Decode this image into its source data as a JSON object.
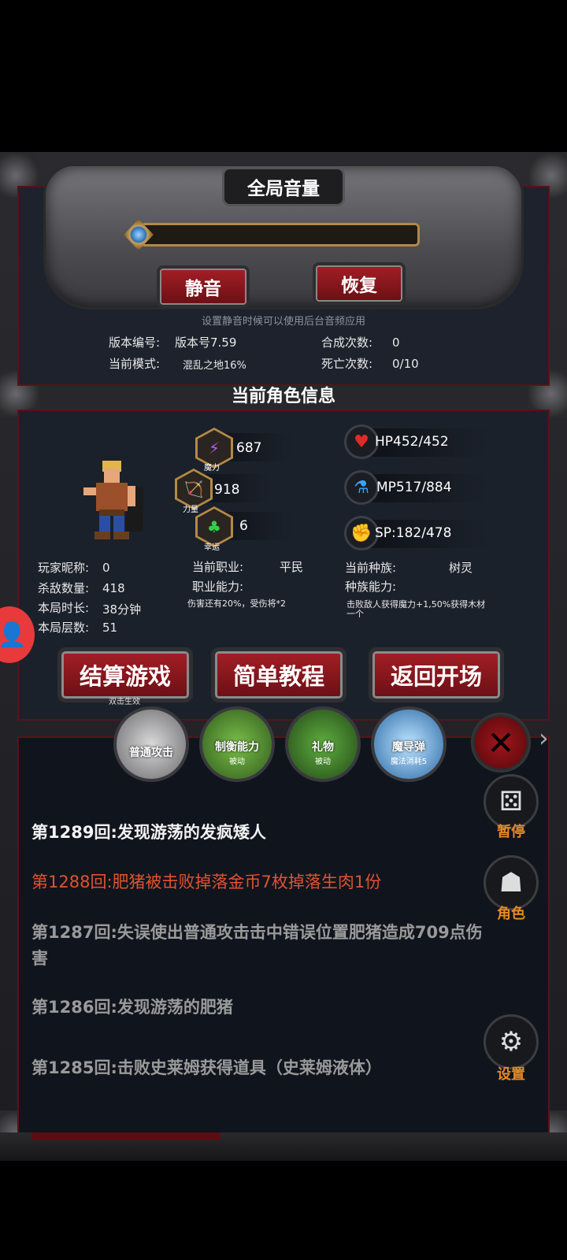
{
  "colors": {
    "accent_red": "#a31f25",
    "log_highlight": "#e0532f",
    "gold": "#b58a45",
    "side_label": "#e48b24"
  },
  "volume": {
    "title": "全局音量",
    "level": 0,
    "mute_label": "静音",
    "restore_label": "恢复",
    "hint": "设置静音时候可以使用后台音频应用"
  },
  "info": {
    "version_label": "版本编号:",
    "version_value": "版本号7.59",
    "mode_label": "当前模式:",
    "mode_value": "混乱之地16%",
    "craft_label": "合成次数:",
    "craft_value": "0",
    "death_label": "死亡次数:",
    "death_value": "0/10"
  },
  "character": {
    "section_title": "当前角色信息",
    "magic_value": "687",
    "magic_caption": "魔力",
    "magic_icon": "lightning-icon",
    "strength_value": "918",
    "strength_caption": "力量",
    "strength_icon": "bow-icon",
    "luck_value": "6",
    "luck_caption": "幸运",
    "luck_icon": "clover-icon",
    "hp": "HP452/452",
    "hp_icon": "heart-icon",
    "mp": "MP517/884",
    "mp_icon": "bottle-icon",
    "sp": "SP:182/478",
    "sp_icon": "muscle-icon",
    "nickname_label": "玩家昵称:",
    "nickname_value": "0",
    "kills_label": "杀敌数量:",
    "kills_value": "418",
    "time_label": "本局时长:",
    "time_value": "38分钟",
    "floor_label": "本局层数:",
    "floor_value": "51",
    "job_label": "当前职业:",
    "job_value": "平民",
    "job_ability_label": "职业能力:",
    "job_ability_value": "伤害还有20%，受伤将*2",
    "race_label": "当前种族:",
    "race_value": "树灵",
    "race_ability_label": "种族能力:",
    "race_ability_value": "击败敌人获得魔力+1,50%获得木材",
    "race_ability_value_2": "一个"
  },
  "actions": {
    "settle_label": "结算游戏",
    "settle_sub": "双击生效",
    "tutorial_label": "简单教程",
    "return_label": "返回开场"
  },
  "skills": [
    {
      "label": "普通攻击",
      "sub": ""
    },
    {
      "label": "制衡能力",
      "sub": "被动"
    },
    {
      "label": "礼物",
      "sub": "被动"
    },
    {
      "label": "魔导弹",
      "sub": "魔法消耗5"
    }
  ],
  "log": [
    {
      "text": "第1289回:发现游荡的发疯矮人",
      "color": "#f2f2f2"
    },
    {
      "text": "第1288回:肥猪被击败掉落金币7枚掉落生肉1份",
      "color": "#e0532f"
    },
    {
      "text": "第1287回:失误使出普通攻击击中错误位置肥猪造成709点伤害",
      "color": "#9a9a9a"
    },
    {
      "text": "第1286回:发现游荡的肥猪",
      "color": "#9a9a9a"
    },
    {
      "text": "第1285回:击败史莱姆获得道具（史莱姆液体）",
      "color": "#9a9a9a"
    }
  ],
  "side": {
    "pause_label": "暂停",
    "pause_icon": "dice-icon",
    "role_label": "角色",
    "role_icon": "hooded-figure-icon",
    "settings_label": "设置",
    "settings_icon": "gear-icon"
  }
}
